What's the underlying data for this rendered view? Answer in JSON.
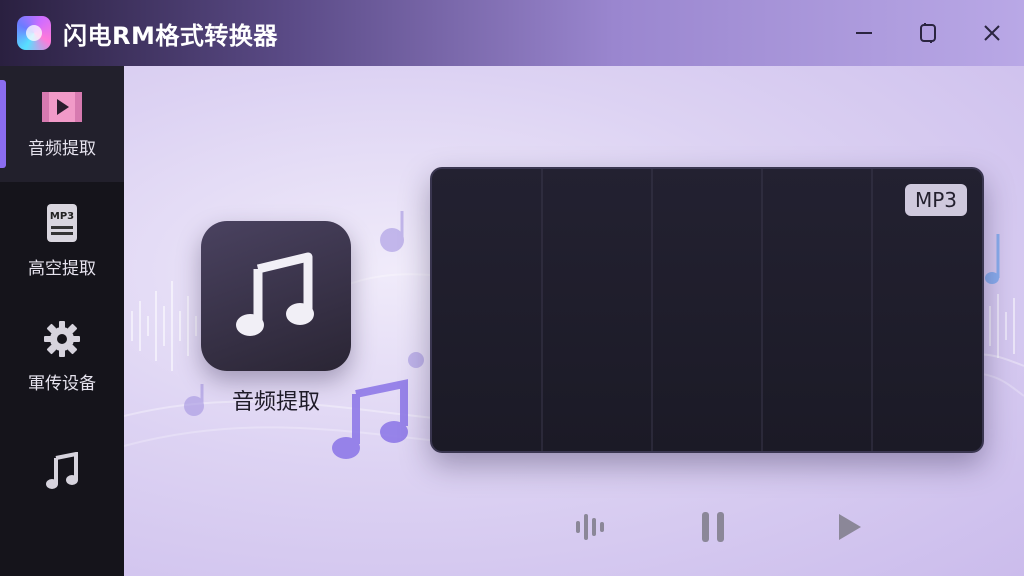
{
  "window": {
    "title": "闪电RM格式转换器",
    "controls": [
      "minimize-icon",
      "restore-icon",
      "close-icon"
    ]
  },
  "sidebar": {
    "items": [
      {
        "label": "音频提取",
        "icon": "video-icon",
        "active": true
      },
      {
        "label": "高空提取",
        "icon": "mp3-file-icon",
        "active": false
      },
      {
        "label": "軍传设备",
        "icon": "gear-icon",
        "active": false
      },
      {
        "label": "",
        "icon": "music-note-icon",
        "active": false
      }
    ]
  },
  "main": {
    "feature": {
      "label": "音频提取",
      "icon": "music-note-icon"
    },
    "waveform": {
      "format": "MP3"
    },
    "playback": {
      "buttons": [
        "waveform-icon",
        "pause-icon",
        "play-icon"
      ]
    }
  },
  "colors": {
    "accent": "#8b6cf0",
    "sidebar_bg": "#15141b",
    "panel_bg": "#1e1c29"
  }
}
